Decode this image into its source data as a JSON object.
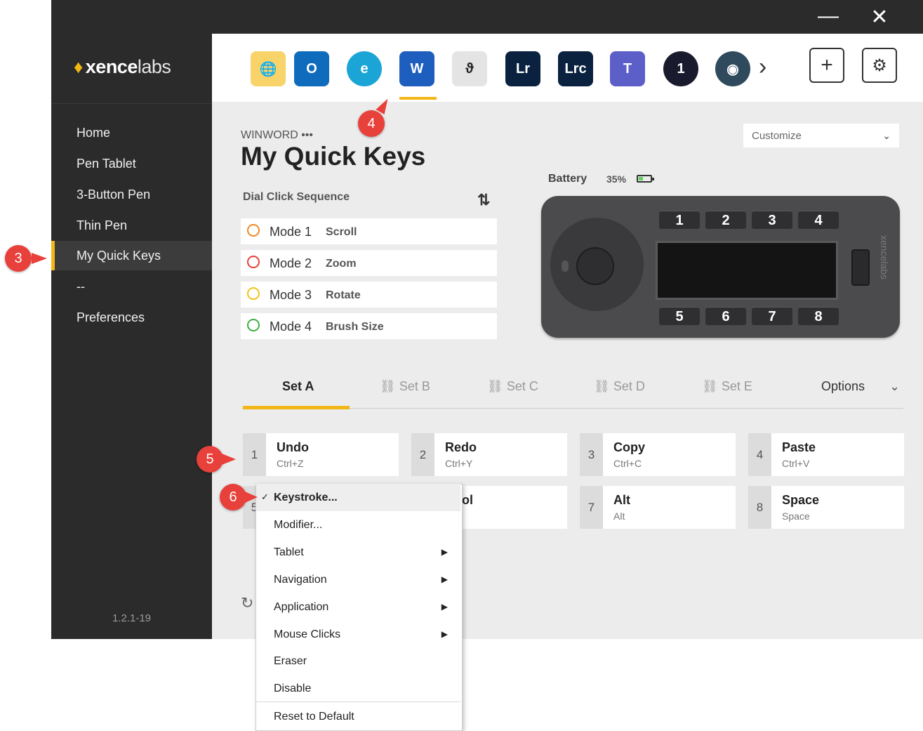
{
  "window": {
    "minimize_glyph": "—",
    "close_glyph": "✕"
  },
  "brand": {
    "logo_bold": "xence",
    "logo_light": "labs",
    "logo_icon": "xencelabs-flame-icon"
  },
  "sidebar": {
    "items": [
      {
        "label": "Home"
      },
      {
        "label": "Pen Tablet"
      },
      {
        "label": "3-Button Pen"
      },
      {
        "label": "Thin Pen"
      },
      {
        "label": "My Quick Keys",
        "active": true
      },
      {
        "label": "--"
      },
      {
        "label": "Preferences"
      }
    ],
    "version": "1.2.1-19"
  },
  "apps": [
    {
      "name": "globe-icon",
      "text": "🌐",
      "bg": "#f7d36a"
    },
    {
      "name": "outlook-icon",
      "text": "O",
      "bg": "#0f6cbd"
    },
    {
      "name": "edge-icon",
      "text": "e",
      "bg": "#1ba5d6"
    },
    {
      "name": "word-icon",
      "text": "W",
      "bg": "#1e5ebf",
      "active": true
    },
    {
      "name": "clip-studio-icon",
      "text": "ϑ",
      "bg": "#e4e4e4"
    },
    {
      "name": "lightroom-icon",
      "text": "Lr",
      "bg": "#0a2240"
    },
    {
      "name": "lightroom-classic-icon",
      "text": "Lrc",
      "bg": "#0a2240"
    },
    {
      "name": "teams-icon",
      "text": "T",
      "bg": "#5b5fc7"
    },
    {
      "name": "affinity-icon",
      "text": "1",
      "bg": "#1a1a2e"
    },
    {
      "name": "app-lens-icon",
      "text": "◉",
      "bg": "#2e4a5c"
    }
  ],
  "toolbar": {
    "more_glyph": "›",
    "add_glyph": "+",
    "settings_glyph": "⚙"
  },
  "header": {
    "app_name": "WINWORD •••",
    "title": "My Quick Keys"
  },
  "customize": {
    "label": "Customize",
    "caret": "⌄"
  },
  "dial": {
    "label": "Dial Click Sequence",
    "swap_glyph": "⇅",
    "modes": [
      {
        "label": "Mode 1",
        "action": "Scroll",
        "color": "#f08a24"
      },
      {
        "label": "Mode 2",
        "action": "Zoom",
        "color": "#e8403a"
      },
      {
        "label": "Mode 3",
        "action": "Rotate",
        "color": "#f2c318"
      },
      {
        "label": "Mode 4",
        "action": "Brush Size",
        "color": "#3cb043"
      }
    ]
  },
  "battery": {
    "label": "Battery",
    "percent": "35%",
    "level": 0.35
  },
  "device": {
    "top_keys": [
      "1",
      "2",
      "3",
      "4"
    ],
    "bottom_keys": [
      "5",
      "6",
      "7",
      "8"
    ],
    "brand": "xencelabs"
  },
  "tabs": [
    {
      "label": "Set A",
      "active": true
    },
    {
      "label": "⛓ Set B"
    },
    {
      "label": "⛓ Set C"
    },
    {
      "label": "⛓ Set D"
    },
    {
      "label": "⛓ Set E"
    }
  ],
  "options": {
    "label": "Options",
    "caret": "⌄"
  },
  "keys": [
    {
      "num": "1",
      "name": "Undo",
      "combo": "Ctrl+Z"
    },
    {
      "num": "2",
      "name": "Redo",
      "combo": "Ctrl+Y"
    },
    {
      "num": "3",
      "name": "Copy",
      "combo": "Ctrl+C"
    },
    {
      "num": "4",
      "name": "Paste",
      "combo": "Ctrl+V"
    },
    {
      "num": "5",
      "name": "",
      "combo": ""
    },
    {
      "num": "6",
      "name": "ntrol",
      "combo": ""
    },
    {
      "num": "7",
      "name": "Alt",
      "combo": "Alt"
    },
    {
      "num": "8",
      "name": "Space",
      "combo": "Space"
    }
  ],
  "context_menu": {
    "check_glyph": "✓",
    "items": [
      {
        "label": "Keystroke...",
        "selected": true
      },
      {
        "label": "Modifier..."
      },
      {
        "label": "Tablet",
        "submenu": true
      },
      {
        "label": "Navigation",
        "submenu": true
      },
      {
        "label": "Application",
        "submenu": true
      },
      {
        "label": "Mouse Clicks",
        "submenu": true
      },
      {
        "label": "Eraser"
      },
      {
        "label": "Disable"
      },
      {
        "label": "Reset to Default"
      }
    ],
    "submenu_glyph": "▶"
  },
  "reset_glyph": "↻",
  "callouts": [
    "3",
    "4",
    "5",
    "6"
  ],
  "colors": {
    "accent": "#f2b616",
    "sidebar": "#2b2b2b",
    "callout": "#e8403a"
  }
}
